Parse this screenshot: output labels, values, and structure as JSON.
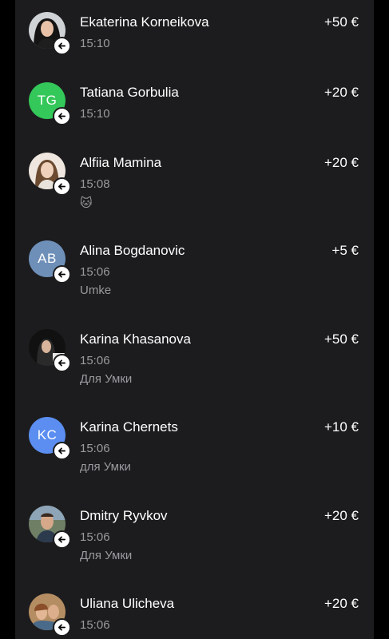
{
  "transactions": [
    {
      "name": "Ekaterina Korneikova",
      "amount": "+50 €",
      "time": "15:10",
      "note": "",
      "avatar_type": "photo",
      "avatar_initials": "",
      "avatar_color": "#3a3a3c"
    },
    {
      "name": "Tatiana Gorbulia",
      "amount": "+20 €",
      "time": "15:10",
      "note": "",
      "avatar_type": "initials",
      "avatar_initials": "TG",
      "avatar_color": "#34c759"
    },
    {
      "name": "Alfiia Mamina",
      "amount": "+20 €",
      "time": "15:08",
      "note": "🐱",
      "avatar_type": "photo",
      "avatar_initials": "",
      "avatar_color": "#d9c9bb"
    },
    {
      "name": "Alina Bogdanovic",
      "amount": "+5 €",
      "time": "15:06",
      "note": "Umke",
      "avatar_type": "initials",
      "avatar_initials": "AB",
      "avatar_color": "#6e8fb8"
    },
    {
      "name": "Karina Khasanova",
      "amount": "+50 €",
      "time": "15:06",
      "note": "Для Умки",
      "avatar_type": "photo",
      "avatar_initials": "",
      "avatar_color": "#1a1a1a"
    },
    {
      "name": "Karina Chernets",
      "amount": "+10 €",
      "time": "15:06",
      "note": "для Умки",
      "avatar_type": "initials",
      "avatar_initials": "KC",
      "avatar_color": "#5b8ef0"
    },
    {
      "name": "Dmitry Ryvkov",
      "amount": "+20 €",
      "time": "15:06",
      "note": "Для Умки",
      "avatar_type": "photo",
      "avatar_initials": "",
      "avatar_color": "#5a6a55"
    },
    {
      "name": "Uliana Ulicheva",
      "amount": "+20 €",
      "time": "15:06",
      "note": "",
      "avatar_type": "photo",
      "avatar_initials": "",
      "avatar_color": "#a07a55"
    }
  ],
  "icons": {
    "incoming": "arrow-left-icon"
  },
  "colors": {
    "background": "#000000",
    "panel": "#1c1c1e",
    "primary_text": "#ffffff",
    "secondary_text": "#9a9a9e"
  }
}
